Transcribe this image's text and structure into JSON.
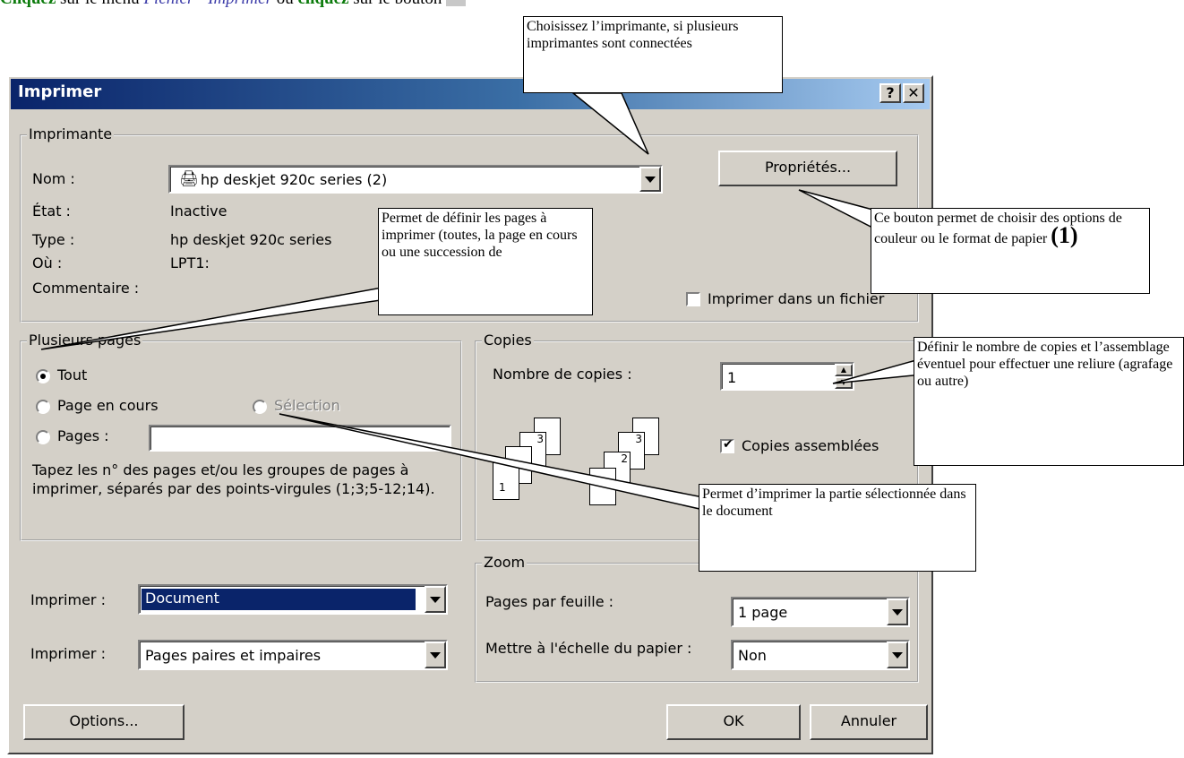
{
  "instruction": {
    "part1": "Cliquez",
    "part2": " sur le menu ",
    "part3": "Fichier - Imprimer",
    "part4": " ou ",
    "part5": "cliquez",
    "part6": " sur le bouton "
  },
  "dialog": {
    "title": "Imprimer",
    "help_btn": "?",
    "close_btn": "✕",
    "printer_group": "Imprimante",
    "name_label": "Nom :",
    "name_value": "hp deskjet 920c series (2)",
    "state_label": "État :",
    "state_value": "Inactive",
    "type_label": "Type :",
    "type_value": "hp deskjet 920c series",
    "where_label": "Où :",
    "where_value": "LPT1:",
    "comment_label": "Commentaire :",
    "properties_btn": "Propriétés...",
    "print_to_file": "Imprimer dans un fichier",
    "pages_group": "Plusieurs pages",
    "radio_all": "Tout",
    "radio_current": "Page en cours",
    "radio_selection": "Sélection",
    "radio_pages": "Pages :",
    "pages_hint": "Tapez les n° des pages et/ou les groupes de pages à imprimer, séparés par des points-virgules (1;3;5-12;14).",
    "copies_group": "Copies",
    "copies_label": "Nombre de copies :",
    "copies_value": "1",
    "collate": "Copies assemblées",
    "print_what_label": "Imprimer :",
    "print_what_value": "Document",
    "print_label2": "Imprimer :",
    "print_value2": "Pages paires et impaires",
    "zoom_group": "Zoom",
    "pps_label": "Pages par feuille :",
    "pps_value": "1 page",
    "scale_label": "Mettre à l'échelle du papier :",
    "scale_value": "Non",
    "options_btn": "Options...",
    "ok_btn": "OK",
    "cancel_btn": "Annuler"
  },
  "callouts": {
    "printer": "Choisissez l’imprimante, si plusieurs imprimantes sont connectées",
    "pages": "Permet de définir les pages à imprimer (toutes, la page en cours ou une succession de",
    "properties_a": "Ce bouton permet de choisir des options de couleur ou le format de papier ",
    "properties_b": "(1)",
    "copies": "Définir le nombre de copies et l’assemblage éventuel pour effectuer une reliure (agrafage ou autre)",
    "selection": "Permet d’imprimer la partie sélectionnée dans le document"
  }
}
